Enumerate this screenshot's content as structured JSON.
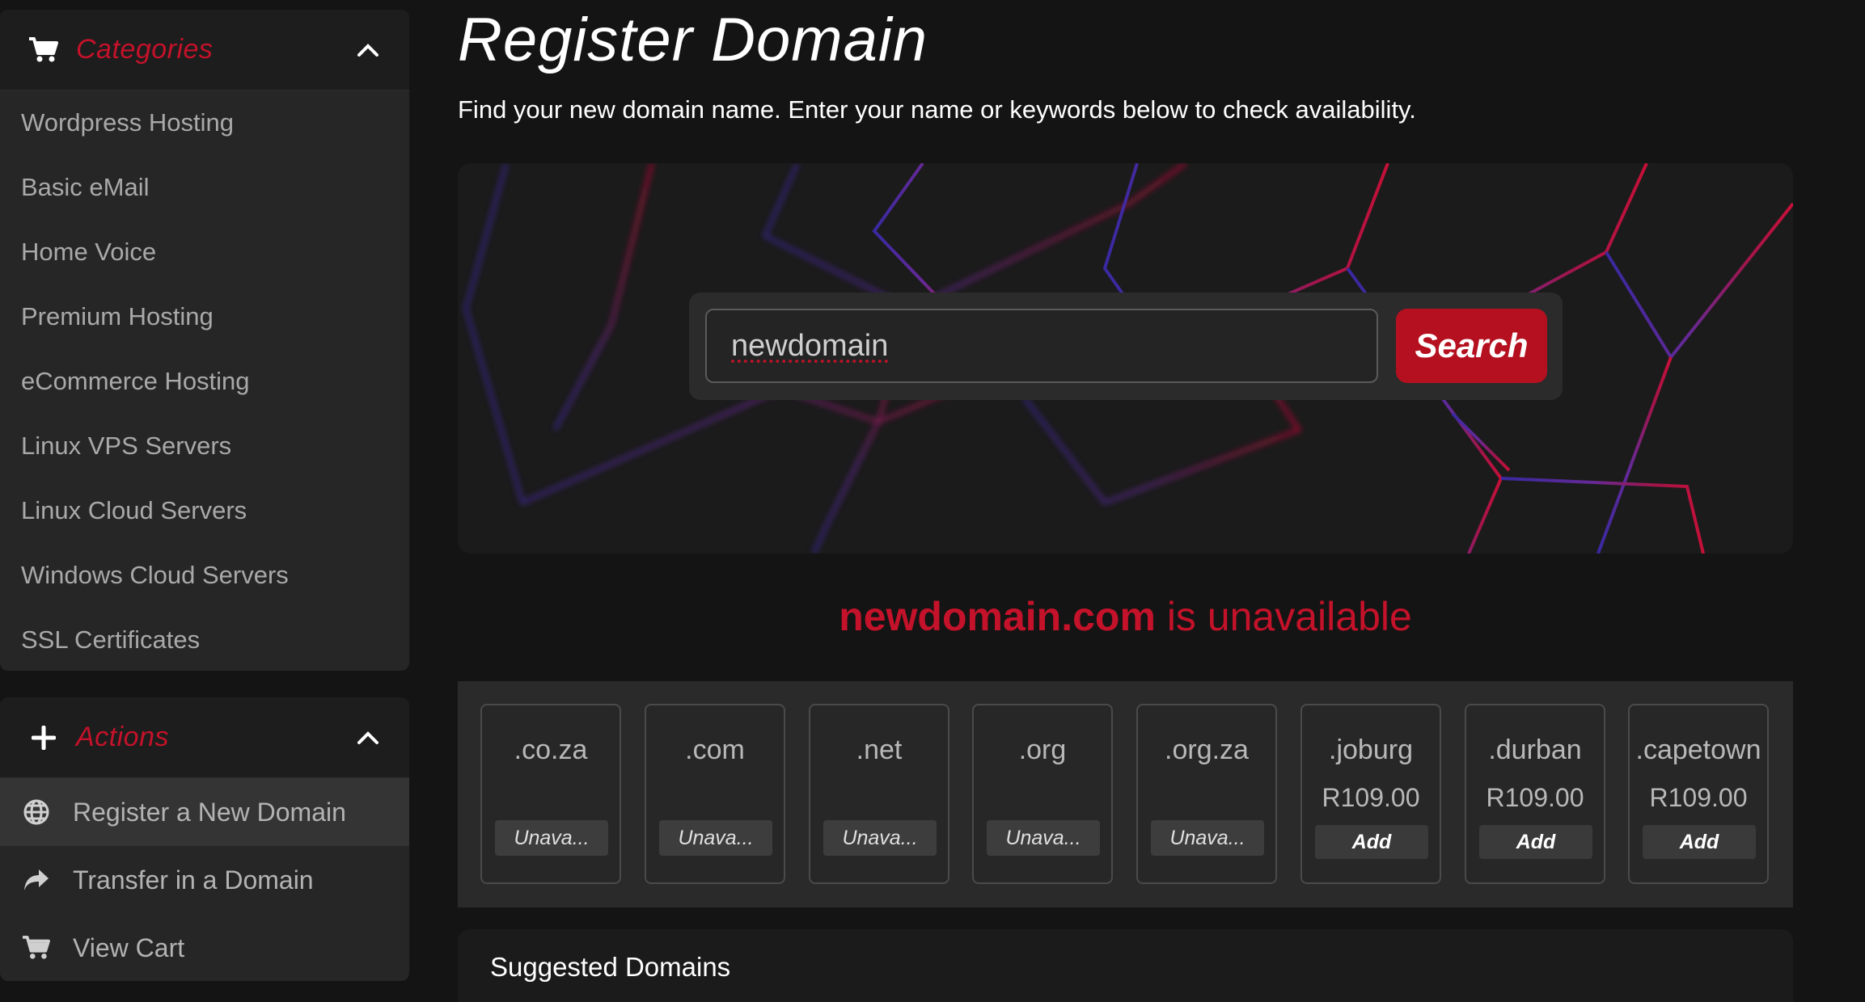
{
  "sidebar": {
    "categories": {
      "title": "Categories",
      "items": [
        "Wordpress Hosting",
        "Basic eMail",
        "Home Voice",
        "Premium Hosting",
        "eCommerce Hosting",
        "Linux VPS Servers",
        "Linux Cloud Servers",
        "Windows Cloud Servers",
        "SSL Certificates"
      ]
    },
    "actions": {
      "title": "Actions",
      "items": [
        {
          "label": "Register a New Domain",
          "icon": "globe-icon",
          "active": true
        },
        {
          "label": "Transfer in a Domain",
          "icon": "share-arrow-icon",
          "active": false
        },
        {
          "label": "View Cart",
          "icon": "cart-icon",
          "active": false
        }
      ]
    }
  },
  "main": {
    "title": "Register Domain",
    "subtitle": "Find your new domain name. Enter your name or keywords below to check availability.",
    "search": {
      "value": "newdomain",
      "button_label": "Search"
    },
    "status": {
      "domain": "newdomain.com",
      "message": " is unavailable"
    },
    "tlds": [
      {
        "name": ".co.za",
        "price": "",
        "action": "Unava..."
      },
      {
        "name": ".com",
        "price": "",
        "action": "Unava..."
      },
      {
        "name": ".net",
        "price": "",
        "action": "Unava..."
      },
      {
        "name": ".org",
        "price": "",
        "action": "Unava..."
      },
      {
        "name": ".org.za",
        "price": "",
        "action": "Unava..."
      },
      {
        "name": ".joburg",
        "price": "R109.00",
        "action": "Add"
      },
      {
        "name": ".durban",
        "price": "R109.00",
        "action": "Add"
      },
      {
        "name": ".capetown",
        "price": "R109.00",
        "action": "Add"
      }
    ],
    "suggested_title": "Suggested Domains"
  },
  "colors": {
    "accent": "#c4122a",
    "button": "#b5101f",
    "background": "#141414",
    "panel": "#262626"
  }
}
